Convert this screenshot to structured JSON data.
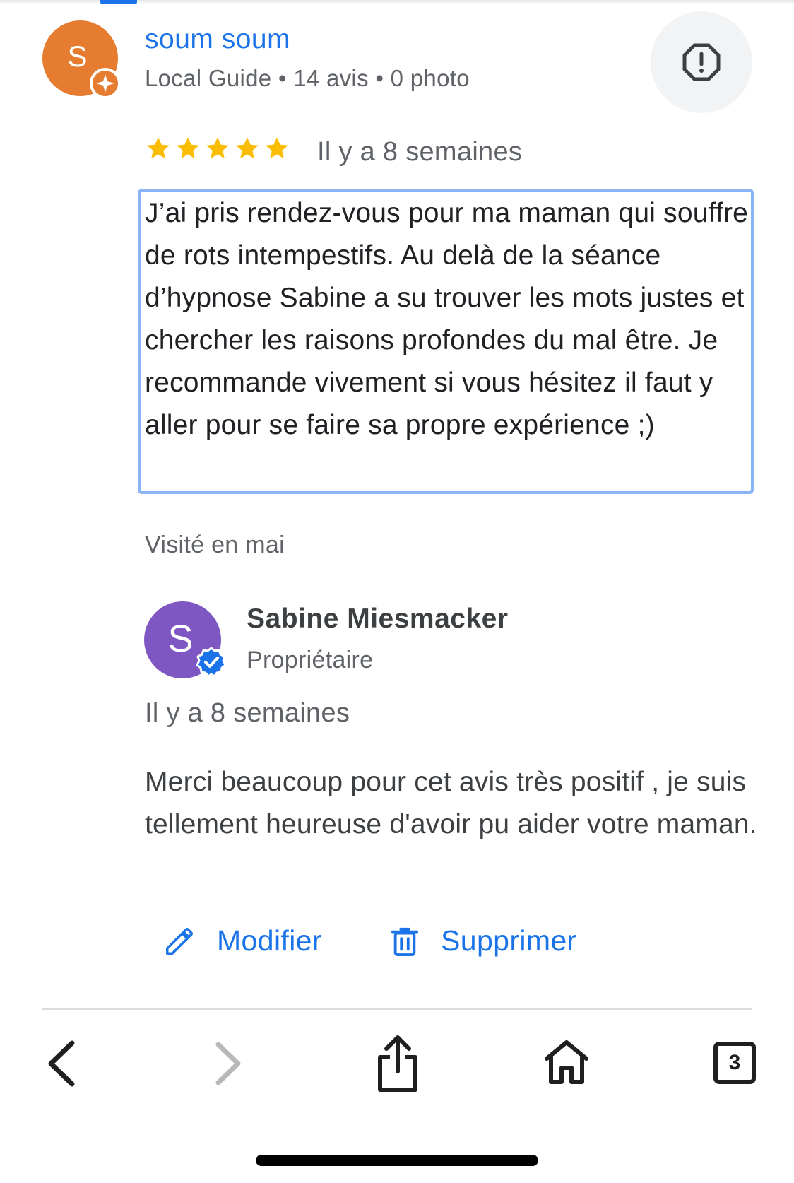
{
  "review": {
    "author": "soum soum",
    "author_initial": "S",
    "author_meta": "Local Guide • 14 avis • 0 photo",
    "rating": 5,
    "date": "Il y a 8 semaines",
    "text": "J’ai pris rendez-vous pour ma maman qui souffre de rots intempestifs. Au delà de la séance d’hypnose Sabine a su trouver les mots justes et chercher les raisons profondes du mal être. Je recommande vivement si vous hésitez il faut y aller pour se faire sa propre expérience ;)",
    "visited": "Visité en mai",
    "avatar_color": "#e67c2f",
    "star_color": "#fbbc04"
  },
  "owner_reply": {
    "name": "Sabine Miesmacker",
    "initial": "S",
    "role": "Propriétaire",
    "date": "Il y a 8 semaines",
    "text": "Merci beaucoup pour cet avis très positif , je suis tellement heureuse d'avoir pu aider votre maman.",
    "avatar_color": "#7e57c2",
    "verified_color": "#1a73e8"
  },
  "actions": {
    "edit_label": "Modifier",
    "delete_label": "Supprimer",
    "accent": "#1a73e8"
  },
  "browser_toolbar": {
    "tab_count": "3",
    "icons": [
      "back-icon",
      "forward-icon",
      "share-icon",
      "home-icon",
      "tabs-icon"
    ]
  }
}
